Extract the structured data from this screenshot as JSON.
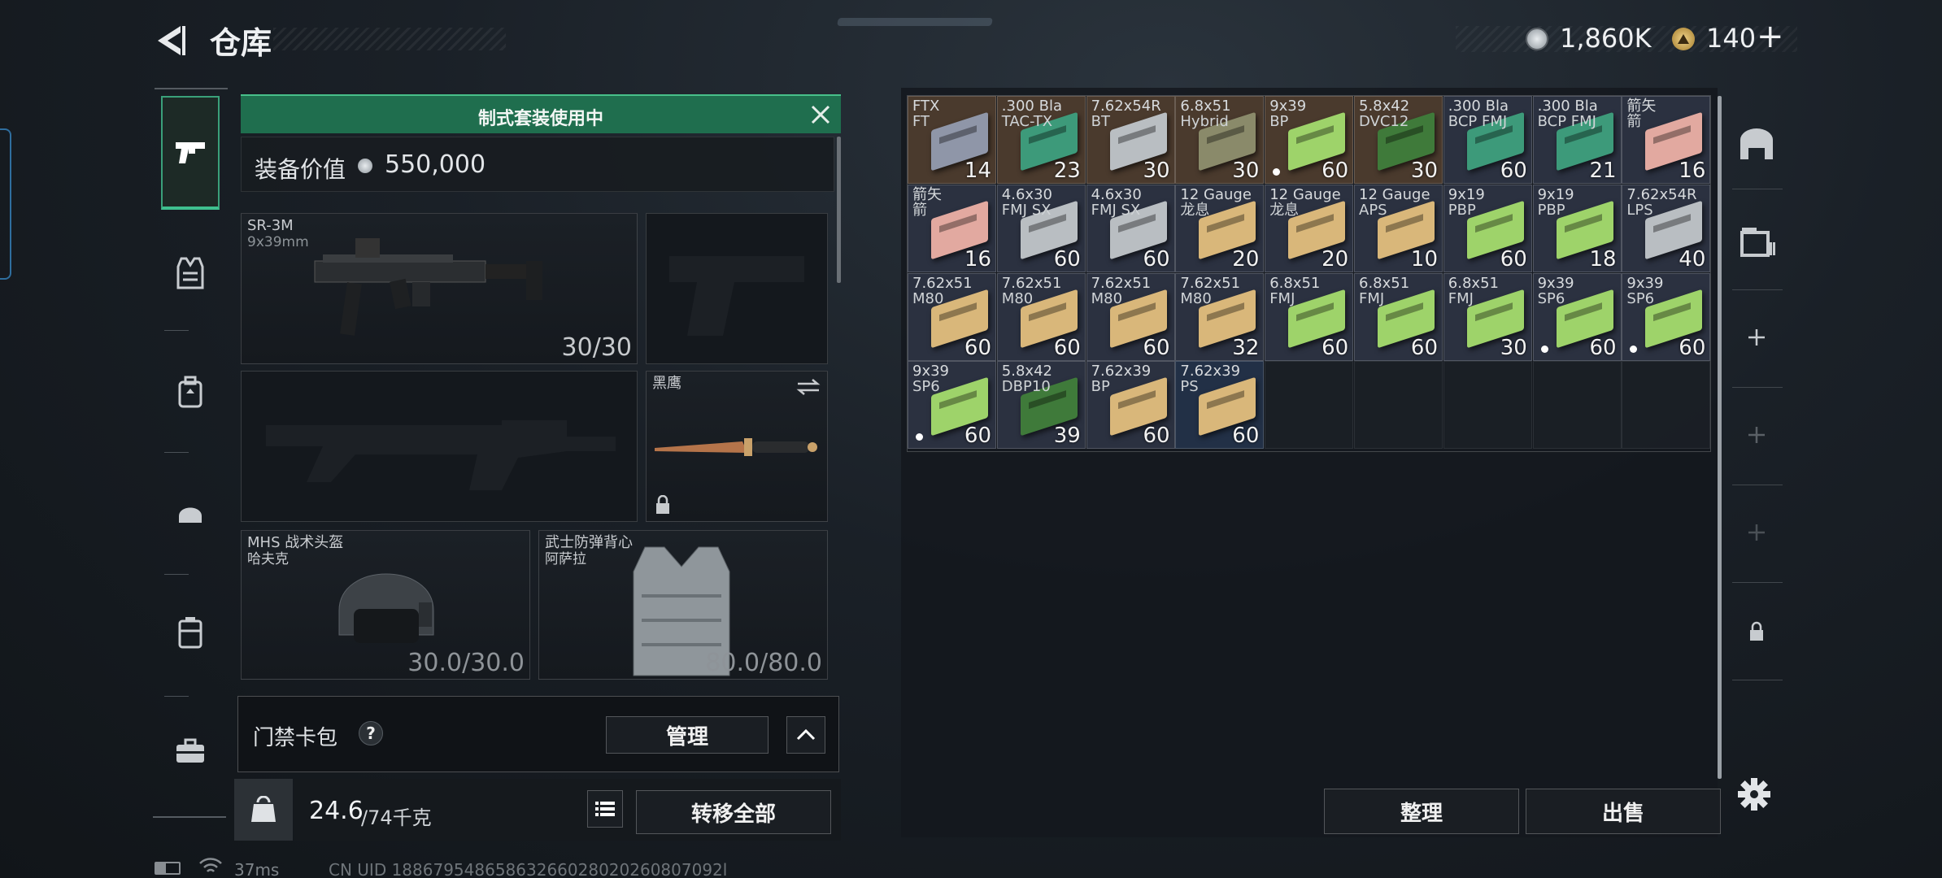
{
  "header": {
    "title": "仓库",
    "currency1": "1,860K",
    "currency2": "140",
    "plus": "+"
  },
  "loadout": {
    "banner": "制式套装使用中",
    "value_label": "装备价值",
    "value": "550,000",
    "primary": {
      "name": "SR-3M",
      "caliber": "9x39mm",
      "ammo": "30/30"
    },
    "melee": {
      "name": "黑鹰"
    },
    "helmet": {
      "name": "MHS 战术头盔",
      "sub": "哈夫克",
      "durability": "30.0/30.0"
    },
    "armor": {
      "name": "武士防弹背心",
      "sub": "阿萨拉",
      "durability": "80.0/80.0"
    },
    "card": {
      "label": "门禁卡包",
      "help": "?",
      "manage": "管理"
    },
    "weight": {
      "current": "24.6",
      "max": "/74千克",
      "kg_icon": "KG"
    },
    "transfer_all": "转移全部"
  },
  "stash": {
    "items": [
      {
        "l1": "FTX",
        "l2": "FT",
        "qty": "14",
        "color": "#8f96a8",
        "bg": "#4a3a2d",
        "dot": false
      },
      {
        "l1": ".300 Bla",
        "l2": "TAC-TX",
        "qty": "23",
        "color": "#3d9a7a",
        "bg": "#4a3a2d",
        "dot": false
      },
      {
        "l1": "7.62x54R",
        "l2": "BT",
        "qty": "30",
        "color": "#b9bec2",
        "bg": "#4a3a2d",
        "dot": false
      },
      {
        "l1": "6.8x51",
        "l2": "Hybrid",
        "qty": "30",
        "color": "#8a8a6a",
        "bg": "#4a3a2d",
        "dot": false
      },
      {
        "l1": "9x39",
        "l2": "BP",
        "qty": "60",
        "color": "#9ed36a",
        "bg": "#4a3a2d",
        "dot": true
      },
      {
        "l1": "5.8x42",
        "l2": "DVC12",
        "qty": "30",
        "color": "#3f7a3a",
        "bg": "#4a3a2d",
        "dot": false
      },
      {
        "l1": ".300 Bla",
        "l2": "BCP FMJ",
        "qty": "60",
        "color": "#3d9a7a",
        "bg": "#2b3140",
        "dot": false
      },
      {
        "l1": ".300 Bla",
        "l2": "BCP FMJ",
        "qty": "21",
        "color": "#3d9a7a",
        "bg": "#2b3140",
        "dot": false
      },
      {
        "l1": "箭矢",
        "l2": "箭",
        "qty": "16",
        "color": "#e2a9a0",
        "bg": "#2b3140",
        "dot": false
      },
      {
        "l1": "箭矢",
        "l2": "箭",
        "qty": "16",
        "color": "#e2a9a0",
        "bg": "#2b3140",
        "dot": false
      },
      {
        "l1": "4.6x30",
        "l2": "FMJ SX",
        "qty": "60",
        "color": "#b9bec2",
        "bg": "#2b3140",
        "dot": false
      },
      {
        "l1": "4.6x30",
        "l2": "FMJ SX",
        "qty": "60",
        "color": "#b9bec2",
        "bg": "#2b3140",
        "dot": false
      },
      {
        "l1": "12 Gauge",
        "l2": "龙息",
        "qty": "20",
        "color": "#d9b77a",
        "bg": "#2b3140",
        "dot": false
      },
      {
        "l1": "12 Gauge",
        "l2": "龙息",
        "qty": "20",
        "color": "#d9b77a",
        "bg": "#2b3140",
        "dot": false
      },
      {
        "l1": "12 Gauge",
        "l2": "APS",
        "qty": "10",
        "color": "#d9b77a",
        "bg": "#2b3140",
        "dot": false
      },
      {
        "l1": "9x19",
        "l2": "PBP",
        "qty": "60",
        "color": "#9ed36a",
        "bg": "#2b3140",
        "dot": false
      },
      {
        "l1": "9x19",
        "l2": "PBP",
        "qty": "18",
        "color": "#9ed36a",
        "bg": "#2b3140",
        "dot": false
      },
      {
        "l1": "7.62x54R",
        "l2": "LPS",
        "qty": "40",
        "color": "#b9bec2",
        "bg": "#2b3140",
        "dot": false
      },
      {
        "l1": "7.62x51",
        "l2": "M80",
        "qty": "60",
        "color": "#d9b77a",
        "bg": "#2b3140",
        "dot": false
      },
      {
        "l1": "7.62x51",
        "l2": "M80",
        "qty": "60",
        "color": "#d9b77a",
        "bg": "#2b3140",
        "dot": false
      },
      {
        "l1": "7.62x51",
        "l2": "M80",
        "qty": "60",
        "color": "#d9b77a",
        "bg": "#2b3140",
        "dot": false
      },
      {
        "l1": "7.62x51",
        "l2": "M80",
        "qty": "32",
        "color": "#d9b77a",
        "bg": "#2b3140",
        "dot": false
      },
      {
        "l1": "6.8x51",
        "l2": "FMJ",
        "qty": "60",
        "color": "#9ed36a",
        "bg": "#2b3140",
        "dot": false
      },
      {
        "l1": "6.8x51",
        "l2": "FMJ",
        "qty": "60",
        "color": "#9ed36a",
        "bg": "#2b3140",
        "dot": false
      },
      {
        "l1": "6.8x51",
        "l2": "FMJ",
        "qty": "30",
        "color": "#9ed36a",
        "bg": "#2b3140",
        "dot": false
      },
      {
        "l1": "9x39",
        "l2": "SP6",
        "qty": "60",
        "color": "#9ed36a",
        "bg": "#2b3140",
        "dot": true
      },
      {
        "l1": "9x39",
        "l2": "SP6",
        "qty": "60",
        "color": "#9ed36a",
        "bg": "#2b3140",
        "dot": true
      },
      {
        "l1": "9x39",
        "l2": "SP6",
        "qty": "60",
        "color": "#9ed36a",
        "bg": "#2b3140",
        "dot": true
      },
      {
        "l1": "5.8x42",
        "l2": "DBP10",
        "qty": "39",
        "color": "#3f7a3a",
        "bg": "#2b3140",
        "dot": false
      },
      {
        "l1": "7.62x39",
        "l2": "BP",
        "qty": "60",
        "color": "#d9b77a",
        "bg": "#2b3140",
        "dot": false
      },
      {
        "l1": "7.62x39",
        "l2": "PS",
        "qty": "60",
        "color": "#d9b77a",
        "bg": "#223046",
        "dot": false
      }
    ],
    "sort": "整理",
    "sell": "出售"
  },
  "statusbar": {
    "ping": "37ms",
    "uid": "CN UID 18867954865863266028020260807092l"
  }
}
